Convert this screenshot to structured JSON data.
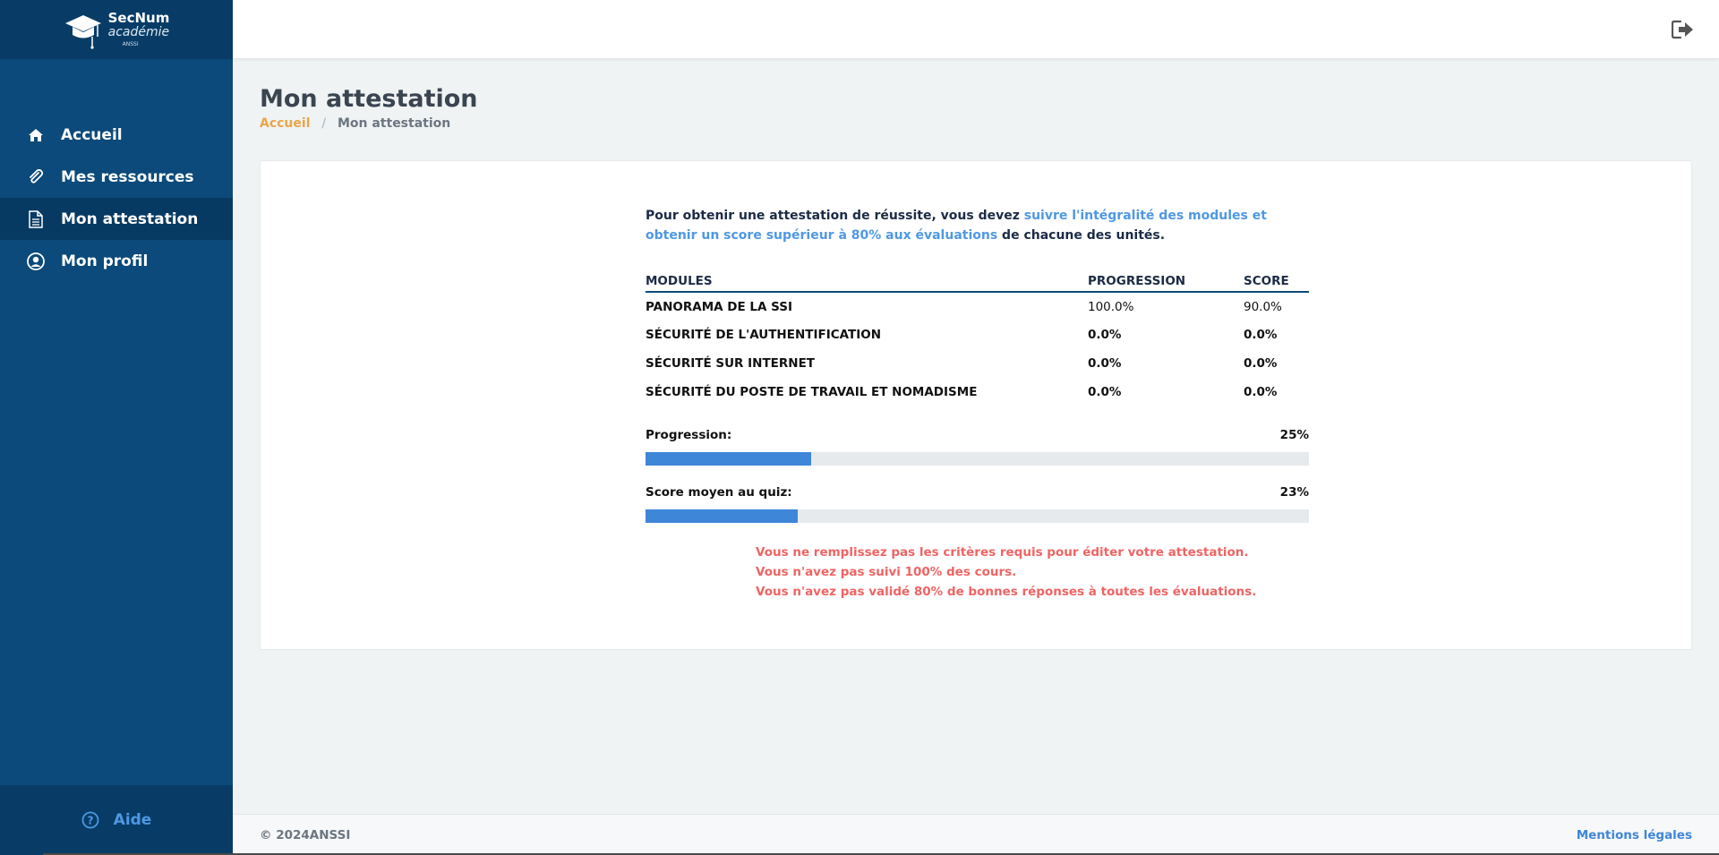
{
  "brand": {
    "line1": "SecNum",
    "line2": "académie",
    "line3": "ANSSI"
  },
  "sidebar": {
    "items": [
      {
        "label": "Accueil",
        "icon": "home-icon",
        "active": false
      },
      {
        "label": "Mes ressources",
        "icon": "paperclip-icon",
        "active": false
      },
      {
        "label": "Mon attestation",
        "icon": "document-icon",
        "active": true
      },
      {
        "label": "Mon profil",
        "icon": "user-circle-icon",
        "active": false
      }
    ],
    "help_label": "Aide"
  },
  "topbar": {
    "logout_icon": "logout-icon"
  },
  "page": {
    "title": "Mon attestation",
    "breadcrumb": {
      "home": "Accueil",
      "separator": "/",
      "current": "Mon attestation"
    }
  },
  "intro": {
    "part1": "Pour obtenir une attestation de réussite, vous devez ",
    "highlight": "suivre l'intégralité des modules et obtenir un score supérieur à 80% aux évaluations",
    "part2": " de chacune des unités."
  },
  "table": {
    "headers": {
      "module": "MODULES",
      "progression": "PROGRESSION",
      "score": "SCORE"
    },
    "rows": [
      {
        "module": "PANORAMA DE LA SSI",
        "progression": "100.0%",
        "score": "90.0%",
        "status": "good"
      },
      {
        "module": "SÉCURITÉ DE L'AUTHENTIFICATION",
        "progression": "0.0%",
        "score": "0.0%",
        "status": "bad"
      },
      {
        "module": "SÉCURITÉ SUR INTERNET",
        "progression": "0.0%",
        "score": "0.0%",
        "status": "bad"
      },
      {
        "module": "SÉCURITÉ DU POSTE DE TRAVAIL ET NOMADISME",
        "progression": "0.0%",
        "score": "0.0%",
        "status": "bad"
      }
    ]
  },
  "progress": {
    "label": "Progression:",
    "value_text": "25%",
    "value": 25
  },
  "quiz": {
    "label": "Score moyen au quiz:",
    "value_text": "23%",
    "value": 23
  },
  "messages": [
    "Vous ne remplissez pas les critères requis pour éditer votre attestation.",
    "Vous n'avez pas suivi 100% des cours.",
    "Vous n'avez pas validé 80% de bonnes réponses à toutes les évaluations."
  ],
  "footer": {
    "copyright": "© 2024ANSSI",
    "legal": "Mentions légales"
  },
  "colors": {
    "sidebar": "#0b4a7a",
    "accent": "#4f98e3",
    "bar_fill": "#3e86d8",
    "success": "#2e9e4f",
    "danger": "#d0021b",
    "warning_text": "#ef6464",
    "breadcrumb_link": "#e9a546"
  }
}
